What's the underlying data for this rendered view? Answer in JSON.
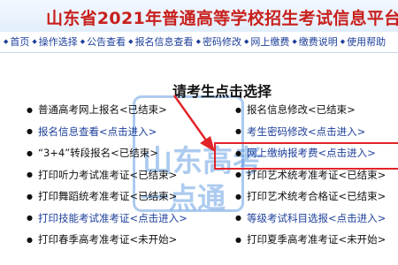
{
  "header": {
    "title": "山东省2021年普通高等学校招生考试信息平台"
  },
  "nav": {
    "items": [
      {
        "label": "首页"
      },
      {
        "label": "操作选择"
      },
      {
        "label": "公告查看"
      },
      {
        "label": "报名信息查看"
      },
      {
        "label": "密码修改"
      },
      {
        "label": "网上缴费"
      },
      {
        "label": "缴费说明"
      },
      {
        "label": "使用帮助"
      }
    ]
  },
  "main": {
    "subtitle": "请考生点击选择",
    "left_items": [
      {
        "label": "普通高考网上报名<已结束>",
        "link": false
      },
      {
        "label": "报名信息查看<点击进入>",
        "link": true
      },
      {
        "label": "“3+4”转段报名<已结束>",
        "link": false
      },
      {
        "label": "打印听力考试准考证<已结束>",
        "link": false
      },
      {
        "label": "打印舞蹈统考准考证<已结束>",
        "link": false
      },
      {
        "label": "打印技能考试准考证<点击进入>",
        "link": true
      },
      {
        "label": "打印春季高考准考证<未开始>",
        "link": false
      }
    ],
    "right_items": [
      {
        "label": "报名信息修改<已结束>",
        "link": false
      },
      {
        "label": "考生密码修改<点击进入>",
        "link": true
      },
      {
        "label": "网上缴纳报考费<点击进入>",
        "link": true
      },
      {
        "label": "打印艺术统考准考证<已结束>",
        "link": false
      },
      {
        "label": "打印艺术统考合格证<已结束>",
        "link": false
      },
      {
        "label": "等级考试科目选报<点击进入>",
        "link": true
      },
      {
        "label": "打印夏季高考准考证<未开始>",
        "link": false
      }
    ]
  },
  "watermark": {
    "line1": "山东高考",
    "line2": "一点通"
  },
  "colors": {
    "title": "#c8201c",
    "link": "#1d3f9a",
    "highlight": "#e2242a"
  }
}
